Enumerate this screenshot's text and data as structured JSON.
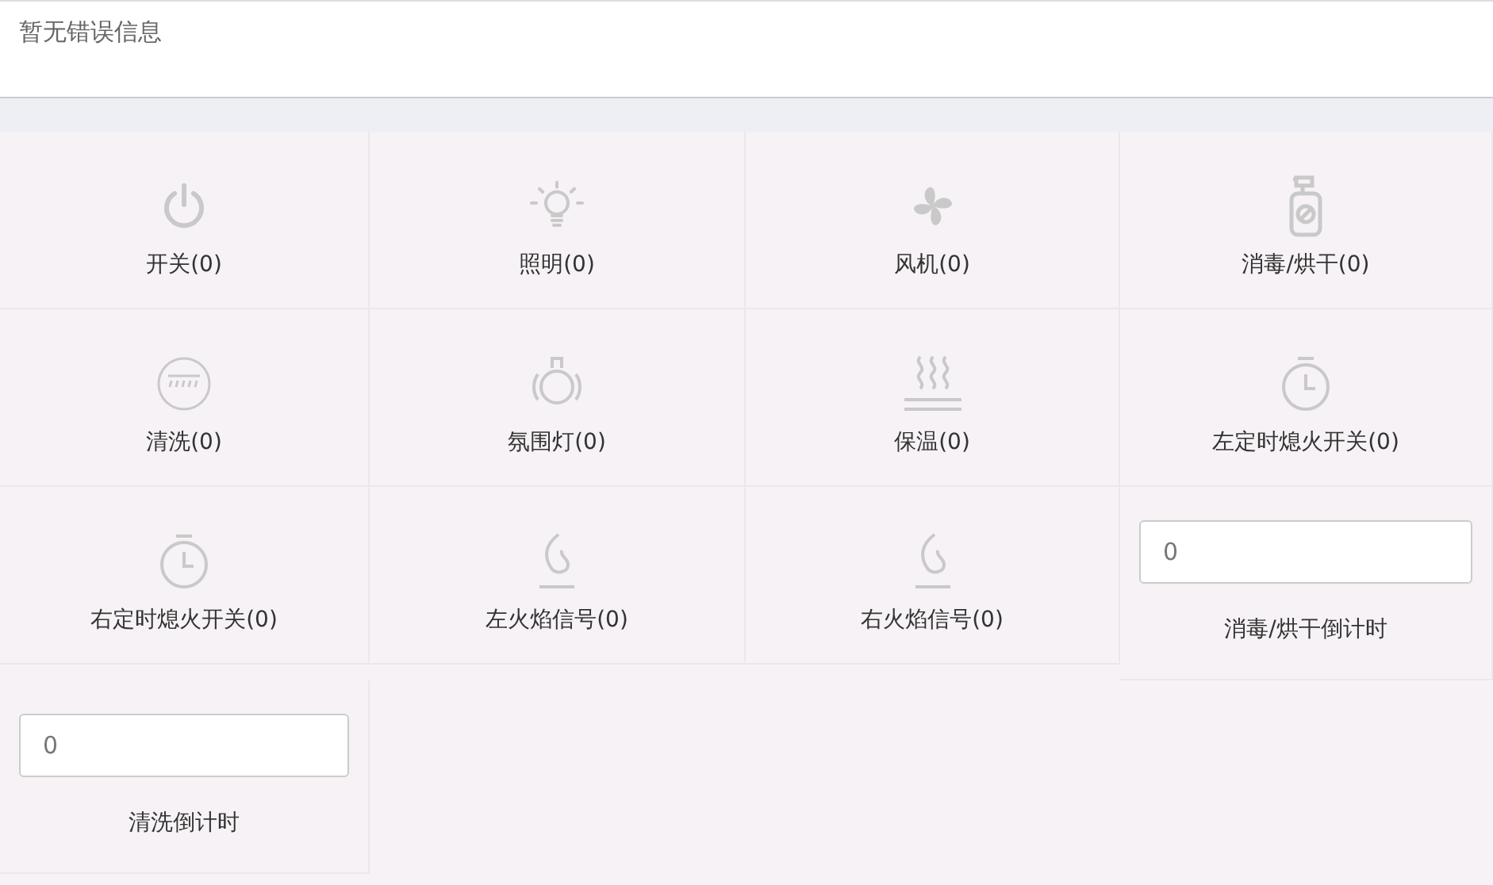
{
  "error_message": "暂无错误信息",
  "items": [
    {
      "kind": "status",
      "label": "开关(0)"
    },
    {
      "kind": "status",
      "label": "照明(0)"
    },
    {
      "kind": "status",
      "label": "风机(0)"
    },
    {
      "kind": "status",
      "label": "消毒/烘干(0)"
    },
    {
      "kind": "status",
      "label": "清洗(0)"
    },
    {
      "kind": "status",
      "label": "氛围灯(0)"
    },
    {
      "kind": "status",
      "label": "保温(0)"
    },
    {
      "kind": "status",
      "label": "左定时熄火开关(0)"
    },
    {
      "kind": "status",
      "label": "右定时熄火开关(0)"
    },
    {
      "kind": "status",
      "label": "左火焰信号(0)"
    },
    {
      "kind": "status",
      "label": "右火焰信号(0)"
    },
    {
      "kind": "counter",
      "value": "0",
      "label": "消毒/烘干倒计时"
    },
    {
      "kind": "counter",
      "value": "0",
      "label": "清洗倒计时"
    }
  ]
}
